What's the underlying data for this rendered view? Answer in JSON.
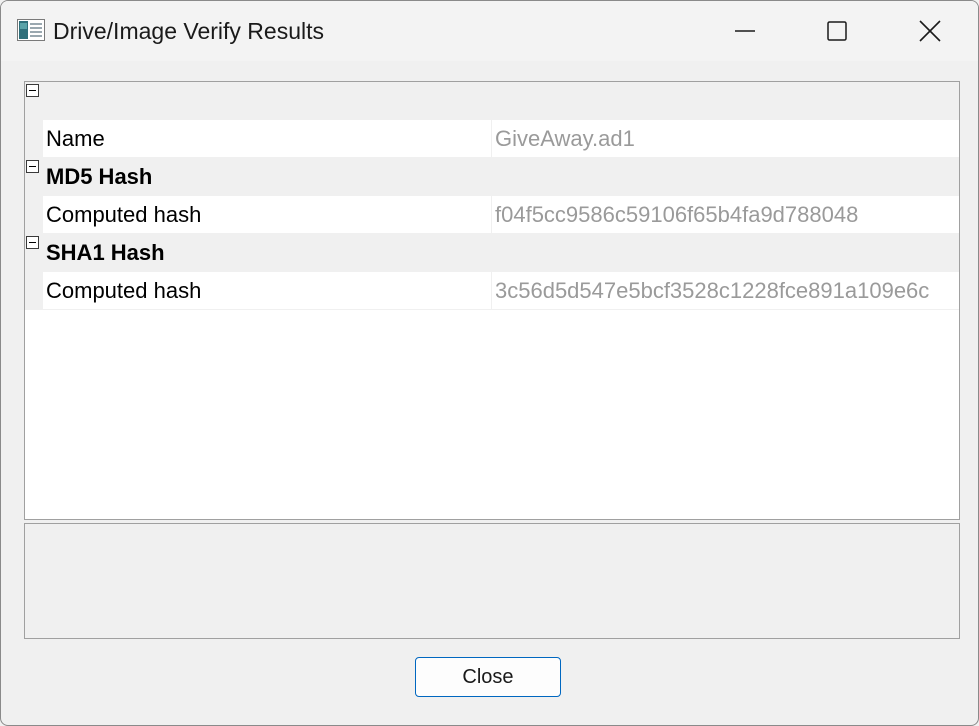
{
  "window": {
    "title": "Drive/Image Verify Results",
    "icon": "drive-image-app-icon",
    "controls": [
      "minimize-icon",
      "maximize-icon",
      "close-icon"
    ]
  },
  "property_grid": {
    "rows": [
      {
        "kind": "category",
        "label": "",
        "expanded": true
      },
      {
        "kind": "property",
        "name": "Name",
        "value": "GiveAway.ad1"
      },
      {
        "kind": "category",
        "label": "MD5 Hash",
        "expanded": true
      },
      {
        "kind": "property",
        "name": "Computed hash",
        "value": "f04f5cc9586c59106f65b4fa9d788048"
      },
      {
        "kind": "category",
        "label": "SHA1 Hash",
        "expanded": true
      },
      {
        "kind": "property",
        "name": "Computed hash",
        "value": "3c56d5d547e5bcf3528c1228fce891a109e6c"
      }
    ]
  },
  "description_panel": {
    "text": ""
  },
  "footer": {
    "close_label": "Close"
  },
  "colors": {
    "accent": "#0067c0",
    "value_text": "#9a9a9a",
    "category_bg": "#f0f0f0"
  }
}
